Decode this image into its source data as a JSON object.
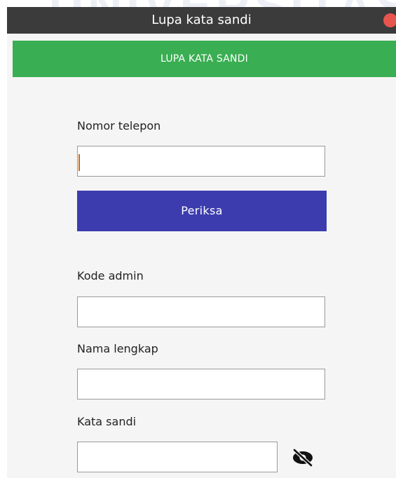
{
  "window": {
    "title": "Lupa kata sandi"
  },
  "header": {
    "title": "LUPA KATA SANDI"
  },
  "form": {
    "phone_label": "Nomor telepon",
    "phone_value": "",
    "check_button_label": "Periksa",
    "admin_code_label": "Kode admin",
    "admin_code_value": "",
    "full_name_label": "Nama lengkap",
    "full_name_value": "",
    "password_label": "Kata sandi",
    "password_value": ""
  },
  "icons": {
    "close": "close-icon",
    "password_visibility": "eye-off-icon"
  },
  "colors": {
    "titlebar": "#3b3b3b",
    "header_green": "#3aae52",
    "button_indigo": "#3c3caf",
    "close_red": "#e8554e"
  }
}
